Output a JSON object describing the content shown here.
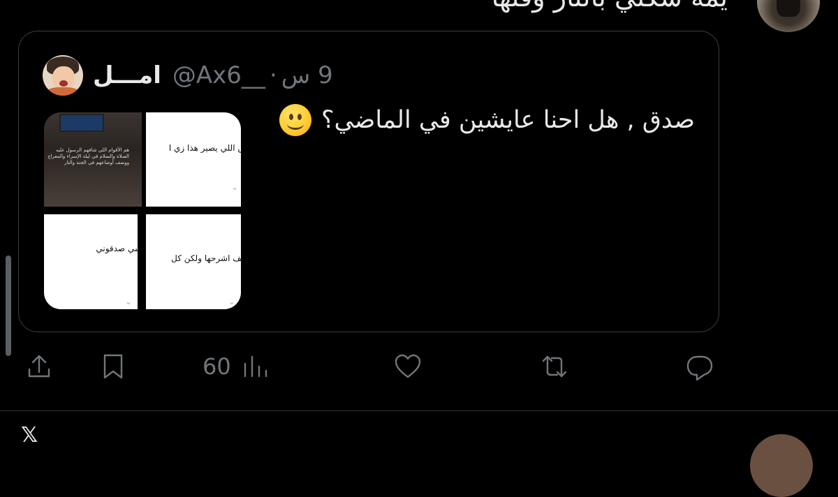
{
  "previous_tweet": {
    "text_fragment": "يمه شكلي بالنار وقتها"
  },
  "quote_tweet": {
    "display_name": "امـــل",
    "handle": "@Ax6__",
    "separator": "·",
    "time": "9 س",
    "text": "صدق , هل احنا عايشين في الماضي؟",
    "emoji": "slightly-smiling-face",
    "media": {
      "tile1_text": "هم الأقوام اللي شافهم الرسول عليه الصلاة والسلام في ليلة الإسراء والمعراج ووصف أوضاعهم في الجنة والنار",
      "tile2_caption": "س اللي يصير هذا زي ا",
      "tile3_caption": "سي صدقوني",
      "tile4_caption": "كيف اشرحها ولكن كل"
    }
  },
  "actions": {
    "share_label": "share",
    "bookmark_label": "bookmark",
    "views_count": "60",
    "like_label": "like",
    "retweet_label": "retweet",
    "reply_label": "reply"
  },
  "next_tweet": {
    "text_fragment": ""
  },
  "colors": {
    "background": "#000000",
    "text": "#e7e9ea",
    "muted": "#71767b",
    "border": "#3a3d40"
  }
}
